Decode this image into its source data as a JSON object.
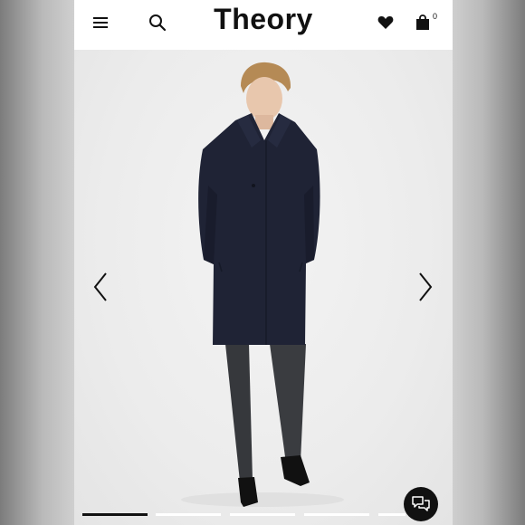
{
  "header": {
    "brand": "Theory",
    "cart_count": "0",
    "icons": [
      "menu-icon",
      "search-icon",
      "heart-icon",
      "shopping-bag-icon"
    ]
  },
  "gallery": {
    "product_image": "model-wearing-navy-wool-overcoat",
    "pages": 5,
    "active_page": 1,
    "prev_icon": "chevron-left-icon",
    "next_icon": "chevron-right-icon"
  },
  "chat": {
    "icon": "chat-bubbles-icon"
  },
  "colors": {
    "coat": "#1f2335",
    "trousers": "#36383c",
    "background": "#efefef",
    "header": "#ffffff"
  }
}
